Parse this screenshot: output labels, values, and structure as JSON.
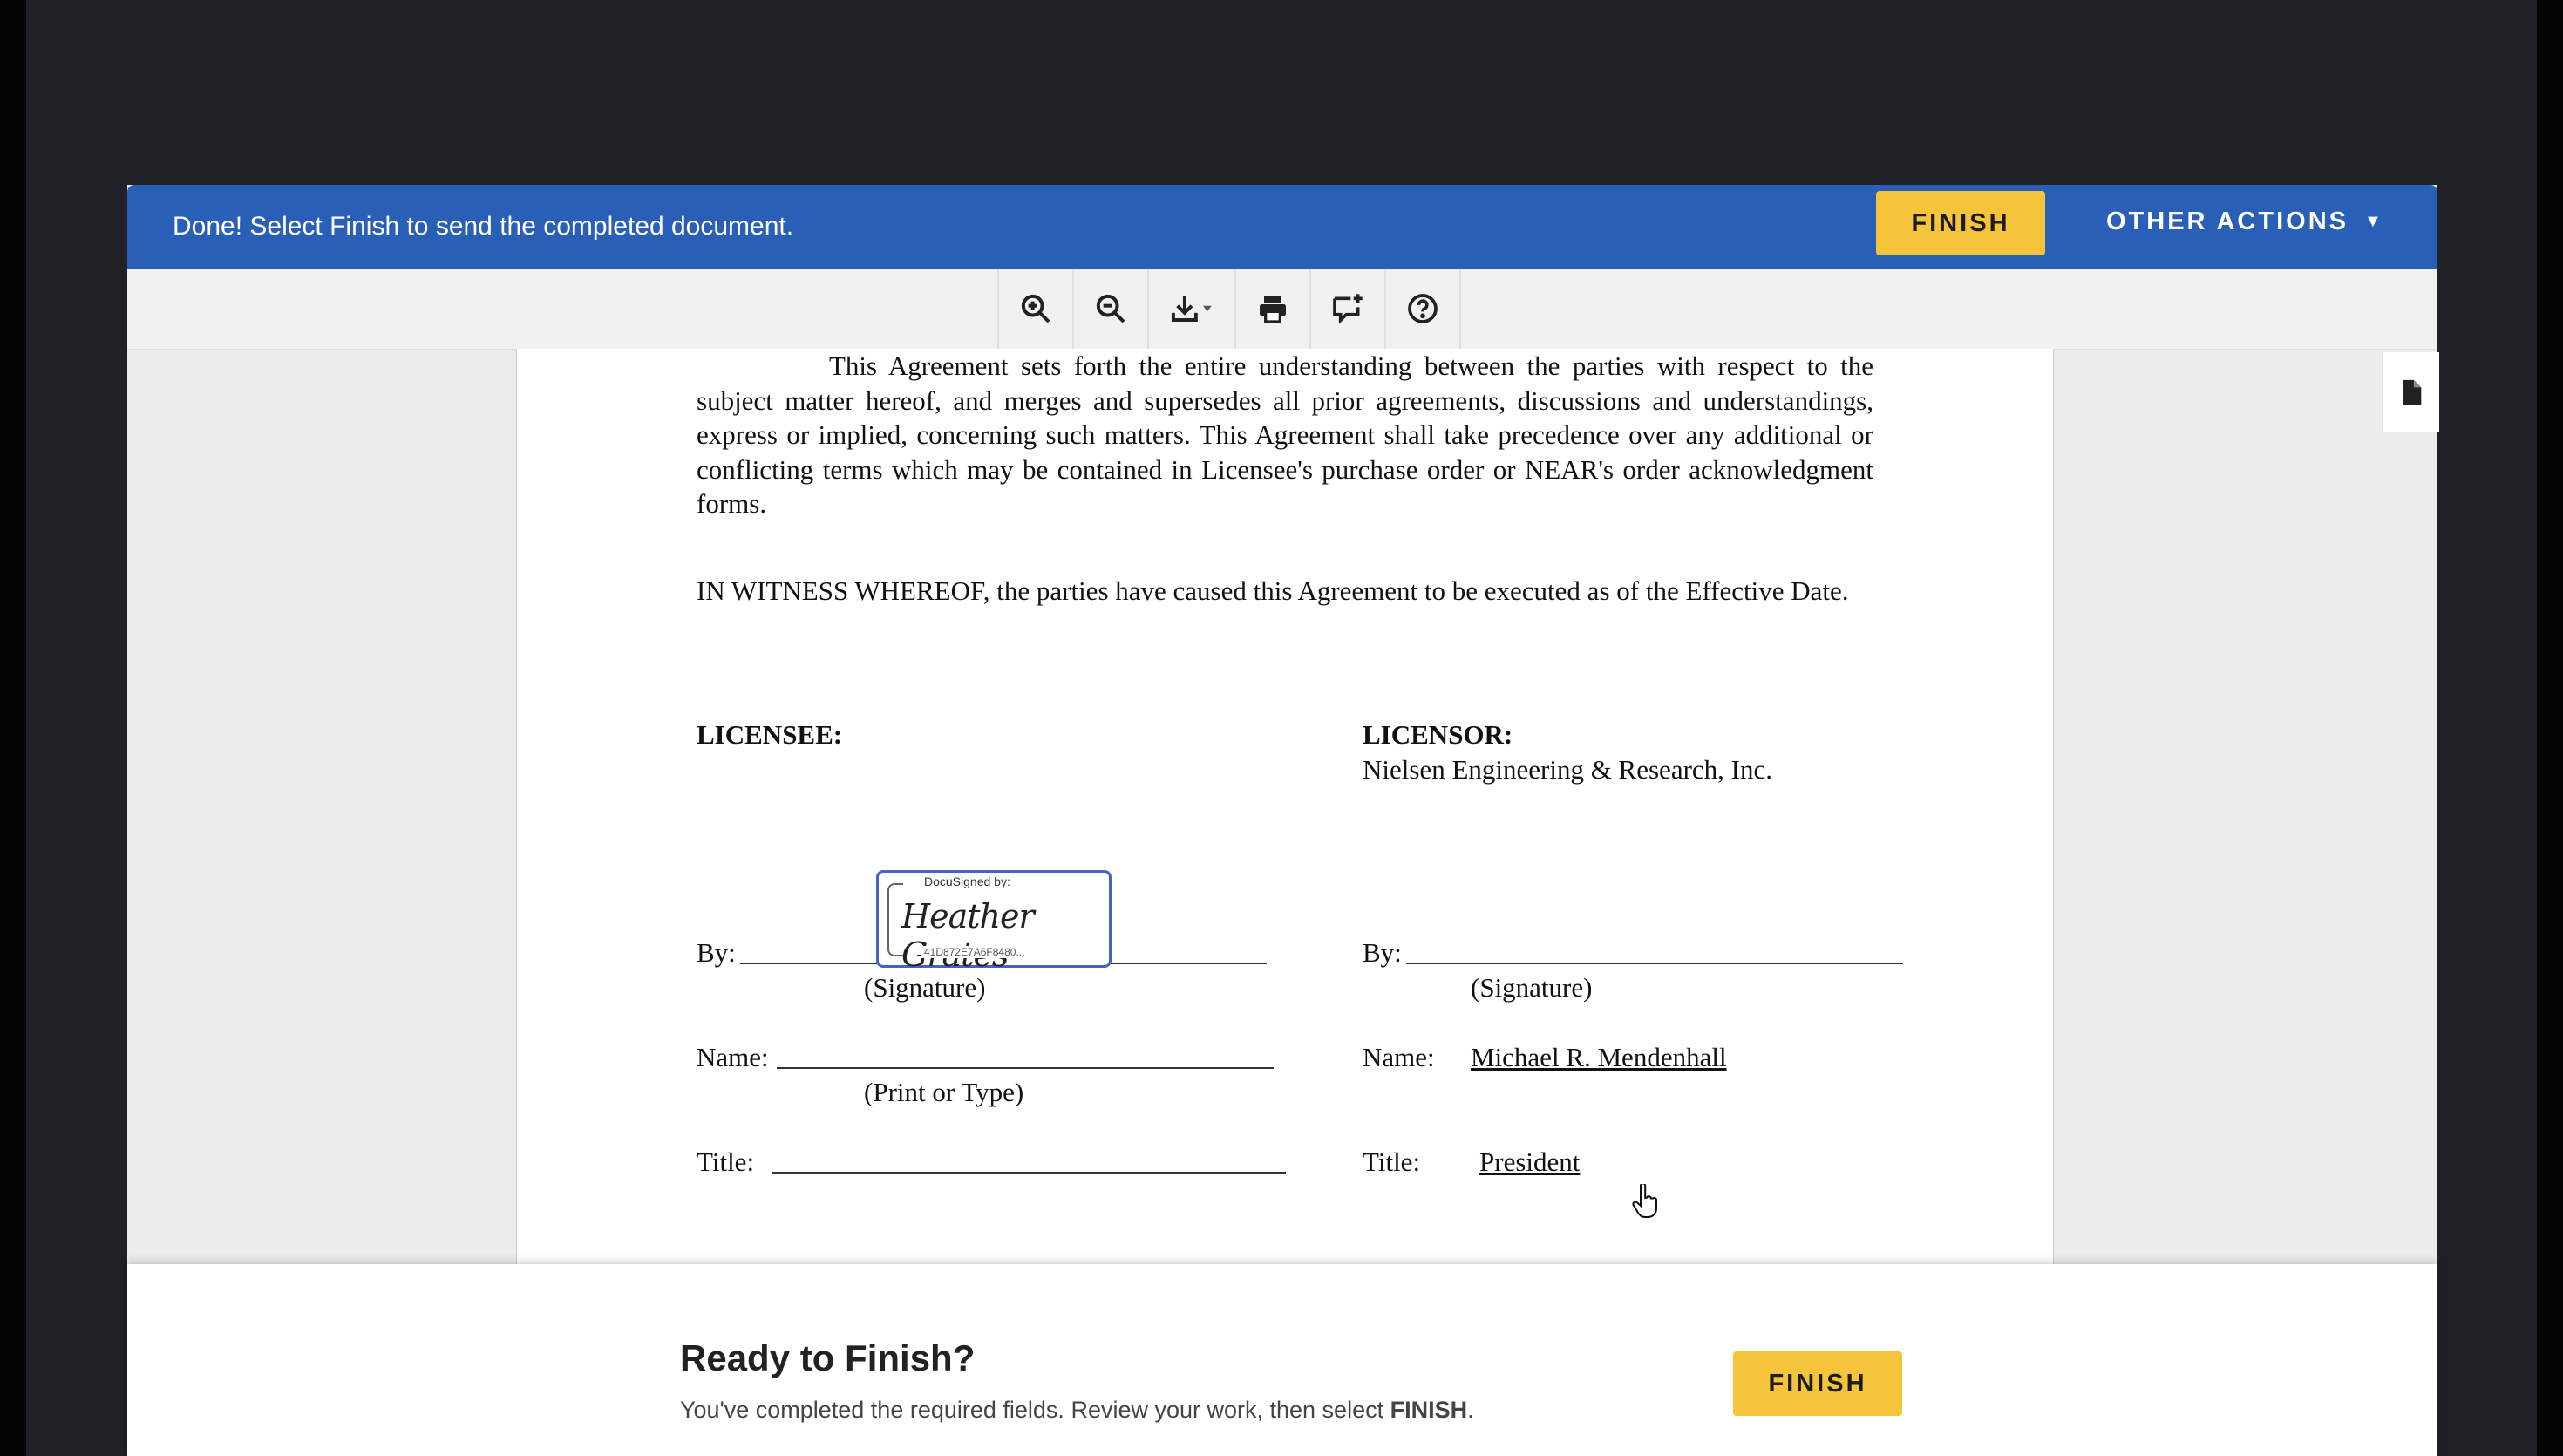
{
  "banner": {
    "message": "Done! Select Finish to send the completed document.",
    "finish_label": "FINISH",
    "other_actions_label": "OTHER ACTIONS",
    "caret": "▼"
  },
  "toolbar": {
    "tools": [
      "zoom-in-icon",
      "zoom-out-icon",
      "download-icon",
      "print-icon",
      "add-comment-icon",
      "help-icon"
    ]
  },
  "document": {
    "paragraph1": "This Agreement sets forth the entire understanding between the parties with respect to the subject matter hereof, and merges and supersedes all prior agreements, discussions and understandings, express or implied, concerning such matters.  This Agreement shall take precedence over any additional or conflicting terms which may be contained in Licensee's purchase order or NEAR's order acknowledgment forms.",
    "paragraph2": "IN WITNESS WHEREOF, the parties have caused this Agreement to be executed as of the Effective Date.",
    "licensee_heading": "LICENSEE:",
    "licensor_heading": "LICENSOR:",
    "licensor_company": "Nielsen Engineering & Research, Inc.",
    "by_label": "By:",
    "signature_caption": "(Signature)",
    "name_label": "Name:",
    "print_caption": "(Print or Type)",
    "title_label": "Title:",
    "licensor_name": "Michael R. Mendenhall",
    "licensor_title": "President",
    "signature": {
      "header": "DocuSigned by:",
      "name": "Heather Grates",
      "envelope_id": "41D872E7A6F8480..."
    }
  },
  "footer": {
    "title": "Ready to Finish?",
    "subtitle_prefix": "You've completed the required fields. Review your work, then select ",
    "subtitle_bold": "FINISH",
    "subtitle_suffix": ".",
    "finish_label": "FINISH"
  }
}
